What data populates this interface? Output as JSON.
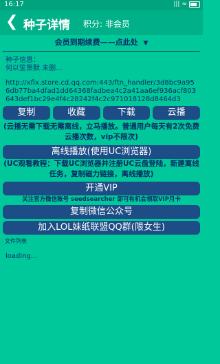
{
  "status": {
    "time": "16:17",
    "signal": "|||",
    "wifi": "≈"
  },
  "header": {
    "back_icon": "back-arrow-icon",
    "title": "种子详情",
    "points": "积分:  非会员"
  },
  "renew": {
    "label": "会员到期续费——点此处",
    "chevron": "chevron-down-icon"
  },
  "seed": {
    "label_line1": "种子信息：",
    "label_line2": "何以笙箫默.未删..."
  },
  "url": "http://xflx.store.cd.qq.com:443/ftn_handler/3d8bc9a956db77ba4dfad1dd64368fadbea4c2a41aa6ef936acf803643def1bc29e4f4c28242f4c2c971018128d8464d3",
  "buttons": {
    "copy": "复制",
    "favorite": "收藏",
    "download": "下载",
    "cloud": "云播"
  },
  "notes": {
    "cloud_tip": "(云播无需下载无需离线，立马播放。普通用户每天有2次免费云播次数，vip不限次)",
    "uc_tip": "(UC观看教程：下载UC浏览器并注册UC云盘登陆，新建离线任务，复制磁力链接，离线播放)"
  },
  "actions": {
    "offline": "离线播放(使用UC浏览器)",
    "vip": "开通VIP",
    "copy_wechat": "复制微信公众号",
    "join_qq": "加入LOL妹纸联盟QQ群(限女生)"
  },
  "gift": "关注官方微信账号 seedsearcher 即可有机会领取VIP月卡",
  "file_list_label": "文件列表",
  "loading": "loading..."
}
